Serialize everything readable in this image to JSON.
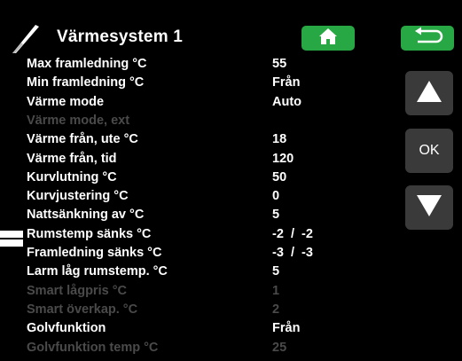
{
  "header": {
    "title": "Värmesystem 1",
    "icons": {
      "heating_system": "thermometer-icon",
      "home": "home-icon",
      "back": "back-arrow-icon"
    }
  },
  "colors": {
    "accent_green": "#27a845",
    "background": "#000000",
    "text": "#ffffff",
    "disabled_text": "#4a4a4a",
    "side_button": "#3a3a3a"
  },
  "settings": [
    {
      "label": "Max framledning °C",
      "value": "55",
      "enabled": true
    },
    {
      "label": "Min framledning °C",
      "value": "Från",
      "enabled": true
    },
    {
      "label": "Värme mode",
      "value": "Auto",
      "enabled": true
    },
    {
      "label": "Värme mode, ext",
      "value": "",
      "enabled": false
    },
    {
      "label": "Värme från, ute °C",
      "value": "18",
      "enabled": true
    },
    {
      "label": "Värme från, tid",
      "value": "120",
      "enabled": true
    },
    {
      "label": "Kurvlutning °C",
      "value": "50",
      "enabled": true
    },
    {
      "label": "Kurvjustering °C",
      "value": "0",
      "enabled": true
    },
    {
      "label": "Nattsänkning av °C",
      "value": "5",
      "enabled": true
    },
    {
      "label": "Rumstemp sänks °C",
      "value": "-2  /  -2",
      "enabled": true
    },
    {
      "label": "Framledning sänks °C",
      "value": "-3  /  -3",
      "enabled": true
    },
    {
      "label": "Larm låg rumstemp. °C",
      "value": "5",
      "enabled": true
    },
    {
      "label": "Smart lågpris °C",
      "value": "1",
      "enabled": false
    },
    {
      "label": "Smart överkap. °C",
      "value": "2",
      "enabled": false
    },
    {
      "label": "Golvfunktion",
      "value": "Från",
      "enabled": true
    },
    {
      "label": "Golvfunktion temp °C",
      "value": "25",
      "enabled": false
    }
  ],
  "side_buttons": {
    "up": "arrow-up-icon",
    "ok_label": "OK",
    "down": "arrow-down-icon"
  }
}
